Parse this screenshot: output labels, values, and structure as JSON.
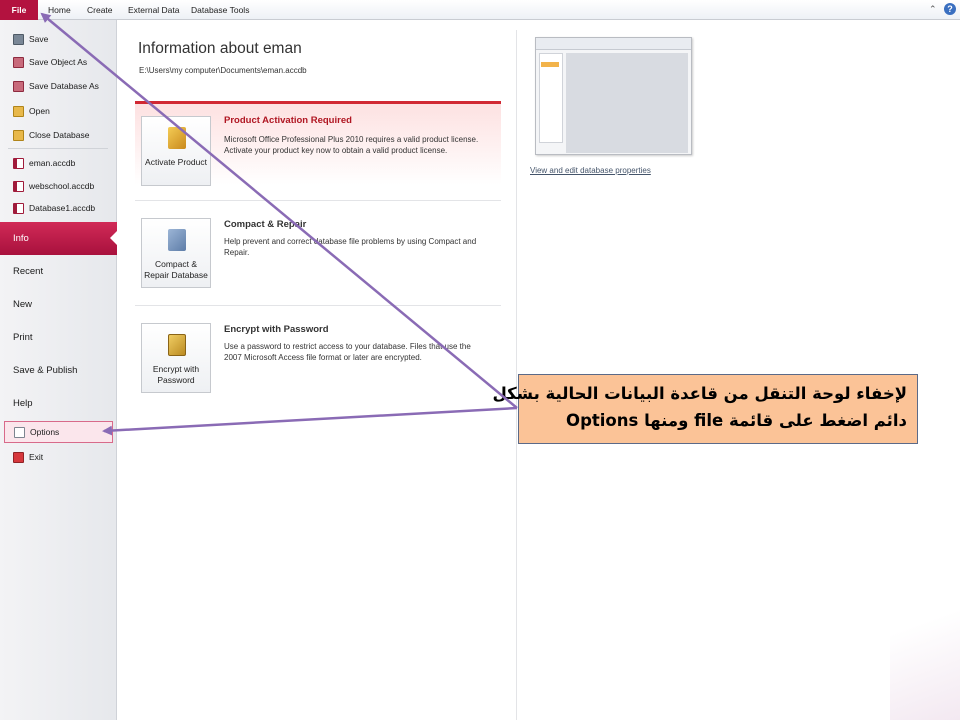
{
  "ribbon": {
    "tabs": [
      "File",
      "Home",
      "Create",
      "External Data",
      "Database Tools"
    ]
  },
  "backstage": {
    "commands": {
      "save": "Save",
      "save_object_as": "Save Object As",
      "save_database_as": "Save Database As",
      "open": "Open",
      "close_database": "Close Database"
    },
    "recent_files": [
      "eman.accdb",
      "webschool.accdb",
      "Database1.accdb"
    ],
    "sections": {
      "info": "Info",
      "recent": "Recent",
      "new": "New",
      "print": "Print",
      "save_publish": "Save & Publish",
      "help": "Help"
    },
    "options": "Options",
    "exit": "Exit"
  },
  "info": {
    "title": "Information about eman",
    "path": "E:\\Users\\my computer\\Documents\\eman.accdb",
    "panels": [
      {
        "button": "Activate Product",
        "title": "Product Activation Required",
        "description": "Microsoft Office Professional Plus 2010 requires a valid product license. Activate your product key now to obtain a valid product license."
      },
      {
        "button": "Compact & Repair Database",
        "title": "Compact & Repair",
        "description": "Help prevent and correct database file problems by using Compact and Repair."
      },
      {
        "button": "Encrypt with Password",
        "title": "Encrypt with Password",
        "description": "Use a password to restrict access to your database. Files that use the 2007 Microsoft Access file format or later are encrypted."
      }
    ],
    "properties_link": "View and edit database properties"
  },
  "annotation": {
    "line1": "لإخفاء لوحة التنقل من قاعدة البيانات الحالية بشكل",
    "line2": "دائم اضغط على  قائمة file ومنها Options"
  },
  "colors": {
    "accent": "#b3123f",
    "callout_fill": "#fbc397",
    "arrow": "#8a6bb5"
  }
}
